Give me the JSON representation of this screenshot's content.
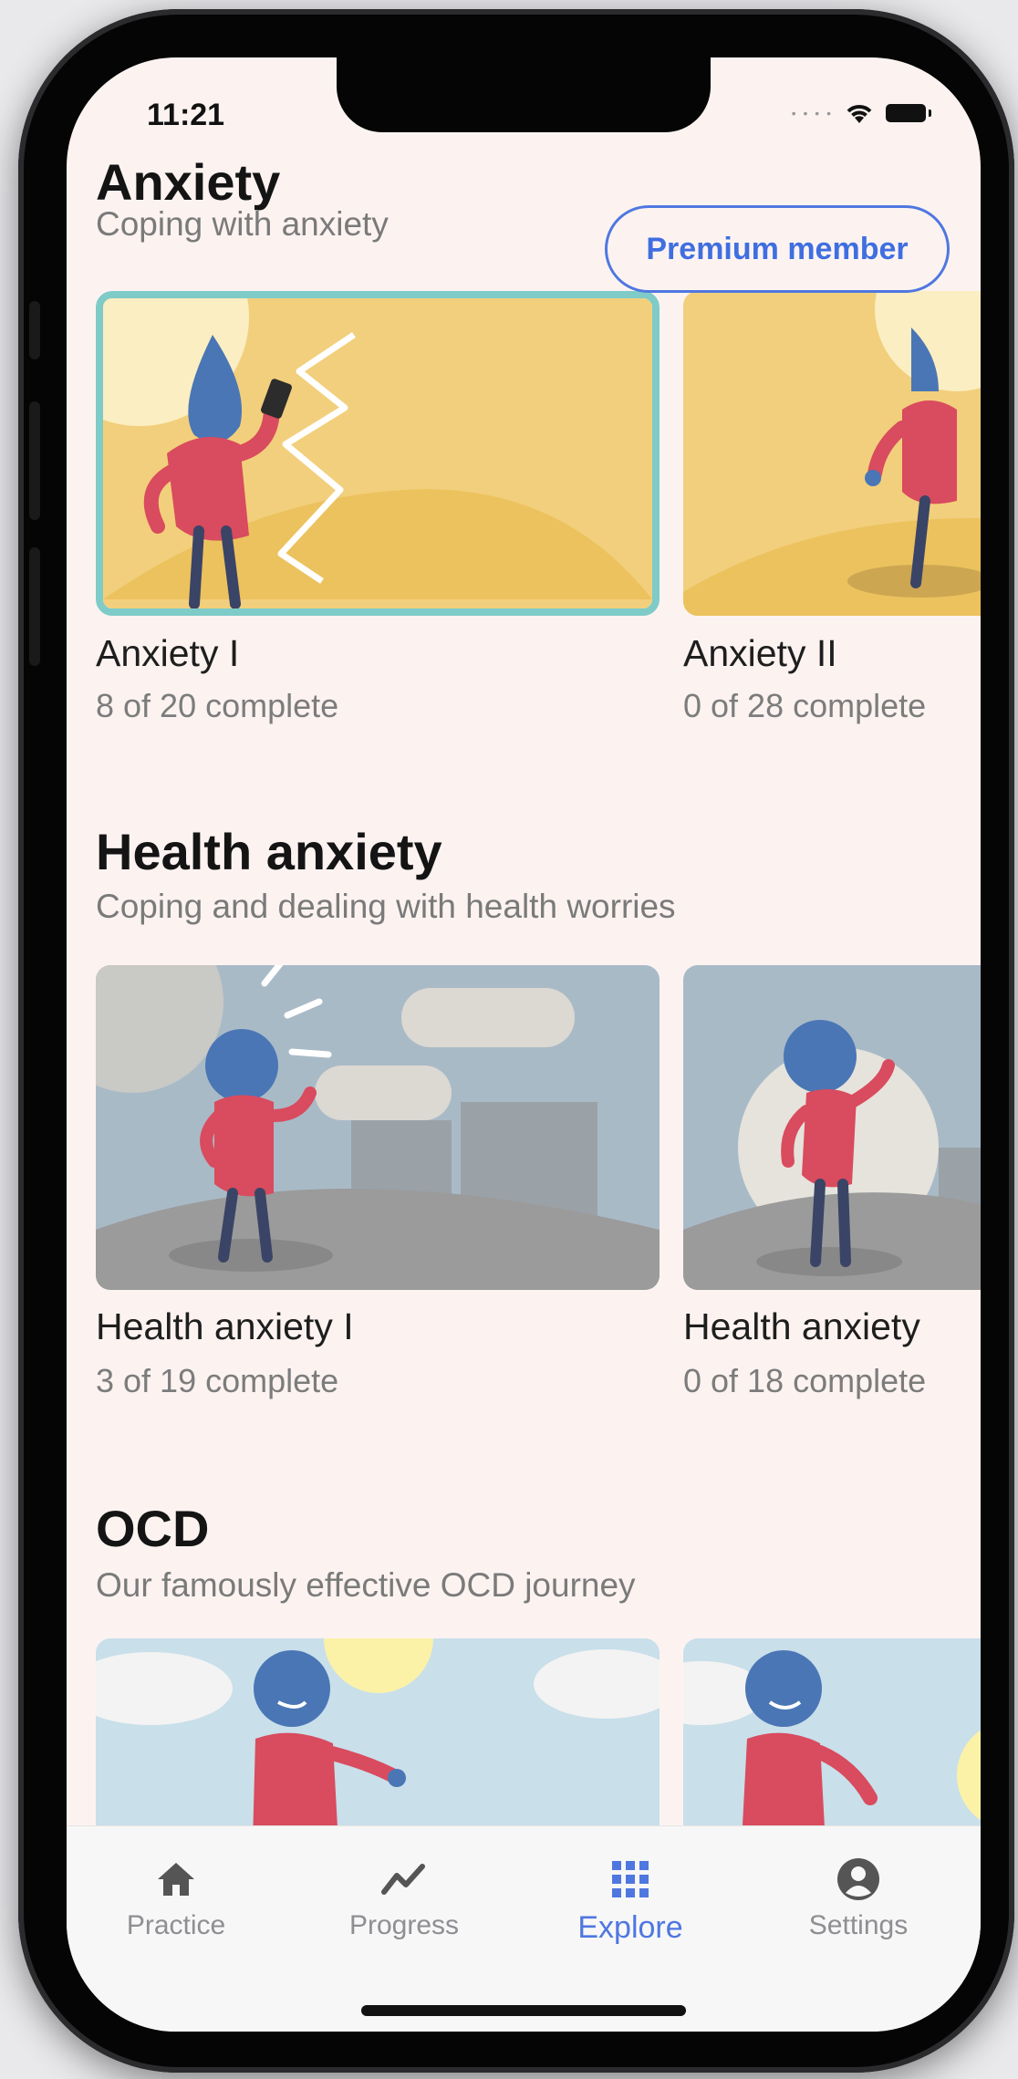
{
  "status_bar": {
    "time": "11:21"
  },
  "premium_badge": {
    "label": "Premium member"
  },
  "sections": [
    {
      "title": "Anxiety",
      "subtitle": "Coping with anxiety",
      "cards": [
        {
          "title": "Anxiety I",
          "progress": "8 of 20 complete",
          "selected": true
        },
        {
          "title": "Anxiety II",
          "progress": "0 of 28 complete"
        }
      ]
    },
    {
      "title": "Health anxiety",
      "subtitle": "Coping and dealing with health worries",
      "cards": [
        {
          "title": "Health anxiety I",
          "progress": "3 of 19 complete"
        },
        {
          "title": "Health anxiety",
          "progress": "0 of 18 complete"
        }
      ]
    },
    {
      "title": "OCD",
      "subtitle": "Our famously effective OCD journey",
      "cards": [
        {
          "title": "",
          "progress": ""
        },
        {
          "title": "",
          "progress": ""
        }
      ]
    }
  ],
  "tabs": [
    {
      "label": "Practice",
      "icon": "home-icon",
      "active": false
    },
    {
      "label": "Progress",
      "icon": "chart-line-icon",
      "active": false
    },
    {
      "label": "Explore",
      "icon": "grid-icon",
      "active": true
    },
    {
      "label": "Settings",
      "icon": "user-circle-icon",
      "active": false
    }
  ],
  "colors": {
    "accent": "#4f77e0",
    "background": "#fcf3f1",
    "selected_border": "#7fcbc8",
    "card_yellow": "#f2cf7c",
    "card_gray_blue": "#a9bac7",
    "card_sky": "#c9dfea"
  }
}
